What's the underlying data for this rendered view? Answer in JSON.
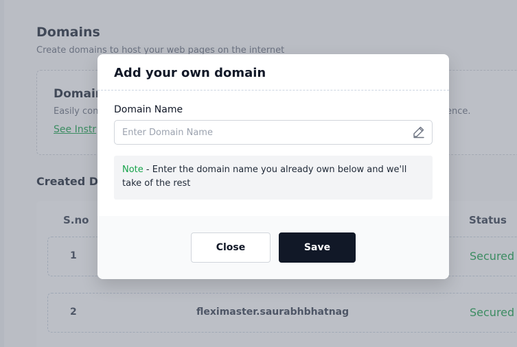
{
  "page": {
    "title": "Domains",
    "subtitle": "Create domains to host your web pages on the internet"
  },
  "info_card": {
    "title": "Domain",
    "description": "Easily con",
    "description_tail": "ence.",
    "link": "See Instr"
  },
  "domains_section": {
    "title": "Created Do"
  },
  "table": {
    "headers": {
      "sno": "S.no",
      "status": "Status"
    },
    "rows": [
      {
        "sno": "1",
        "domain": "",
        "status": "Secured"
      },
      {
        "sno": "2",
        "domain": "fleximaster.saurabhbhatnag",
        "status": "Secured"
      }
    ]
  },
  "modal": {
    "title": "Add your own domain",
    "field_label": "Domain Name",
    "input_value": "",
    "input_placeholder": "Enter Domain Name",
    "note_label": "Note",
    "note_text": " - Enter the domain name you already own below and we'll take of the rest",
    "close_label": "Close",
    "save_label": "Save"
  },
  "colors": {
    "accent_green": "#16a34a",
    "primary_dark": "#111827"
  },
  "icons": {
    "input_icon": "pencil-edit-icon"
  }
}
